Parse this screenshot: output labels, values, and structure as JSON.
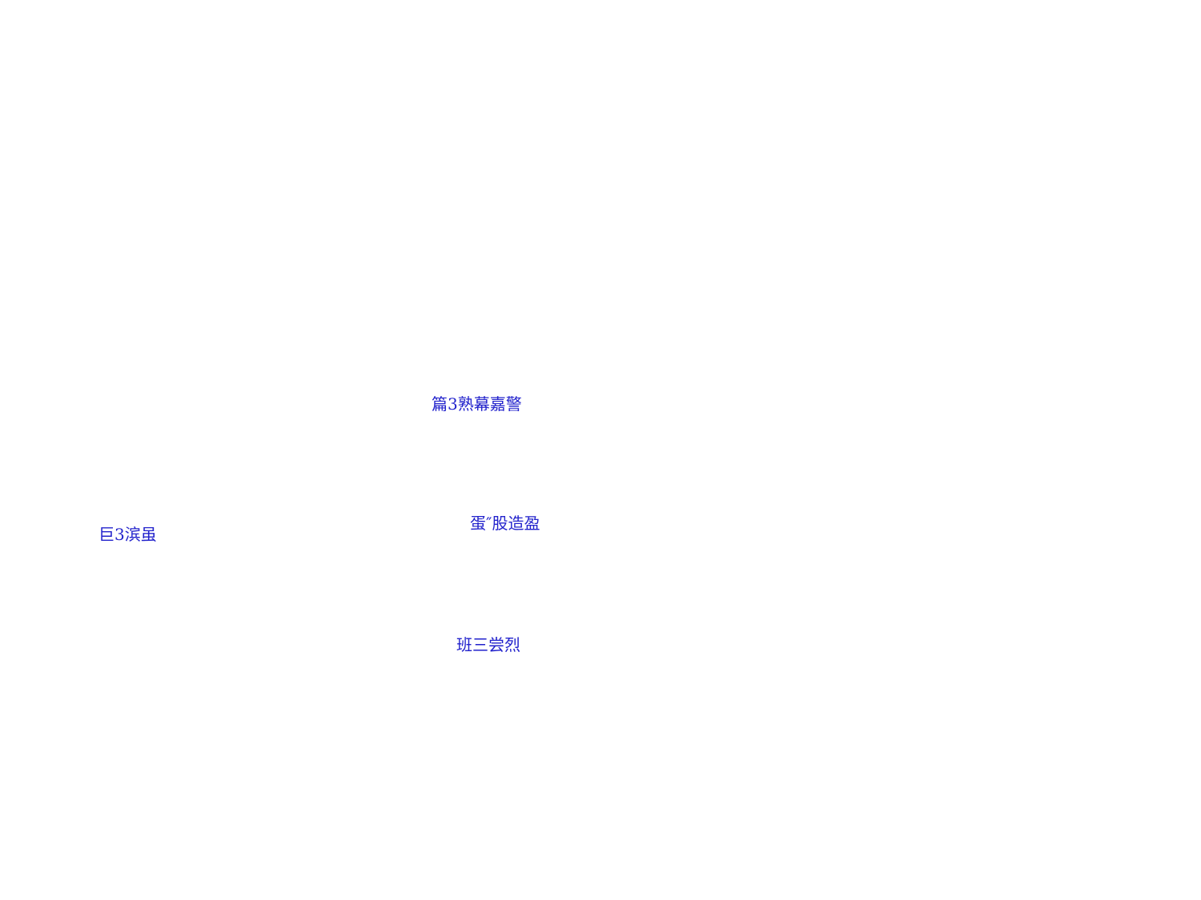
{
  "colors": {
    "background": "#ffffff",
    "label": "#2222cc"
  },
  "nodes": [
    {
      "id": "left",
      "text": "巨3滨虽"
    },
    {
      "id": "top",
      "text": "篇3熟幕嘉警"
    },
    {
      "id": "middle",
      "text": "蛋″股造盈"
    },
    {
      "id": "bottom",
      "text": "班三尝烈"
    }
  ]
}
